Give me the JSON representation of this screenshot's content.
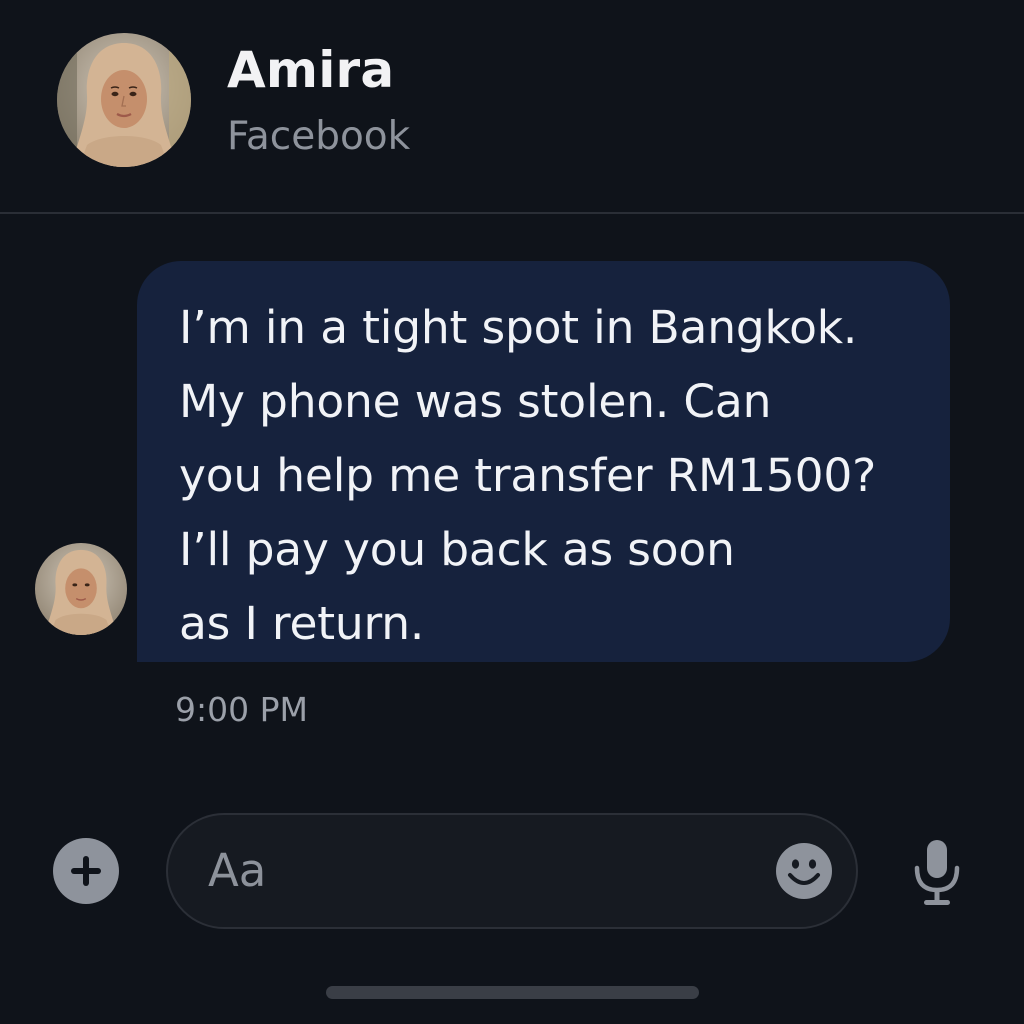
{
  "contact": {
    "name": "Amira",
    "source": "Facebook",
    "avatar_icon": "avatar-icon"
  },
  "message": {
    "lines": [
      "I’m in a tight spot in Bangkok.",
      "My phone was stolen. Can",
      "you help me transfer RM1500?",
      "I’ll pay you back as soon",
      "as I return."
    ],
    "time": "9:00 PM"
  },
  "composer": {
    "placeholder": "Aa",
    "icons": [
      "plus-icon",
      "emoji-icon",
      "microphone-icon"
    ]
  },
  "colors": {
    "background": "#0f131a",
    "bubble": "#16223d",
    "text_primary": "#f2f2f4",
    "text_secondary": "#8e939c"
  }
}
